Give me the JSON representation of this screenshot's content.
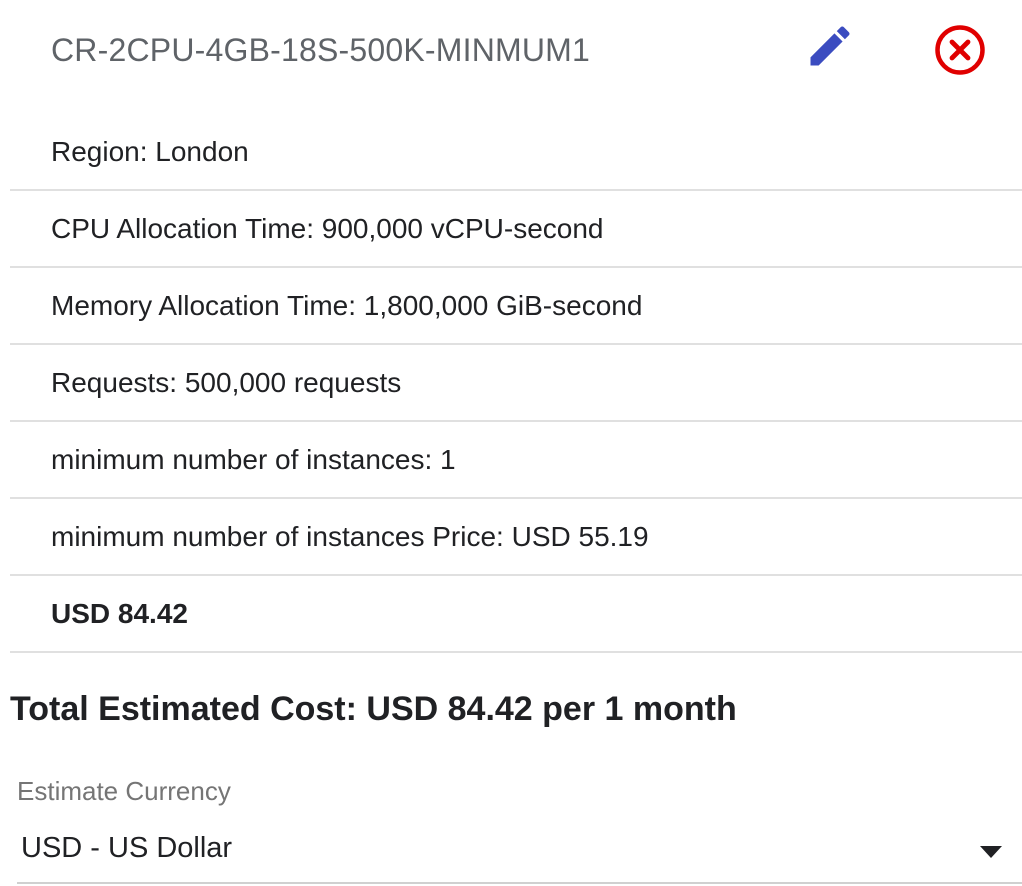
{
  "estimate_item": {
    "title": "CR-2CPU-4GB-18S-500K-MINMUM1",
    "edit_icon": "pencil-icon",
    "close_icon": "close-circle-icon",
    "accent_color": "#3b4cc0",
    "close_color": "#e00000",
    "details": [
      {
        "text": "Region: London"
      },
      {
        "text": "CPU Allocation Time: 900,000 vCPU-second"
      },
      {
        "text": "Memory Allocation Time: 1,800,000 GiB-second"
      },
      {
        "text": "Requests: 500,000 requests"
      },
      {
        "text": "minimum number of instances: 1"
      },
      {
        "text": "minimum number of instances Price: USD 55.19"
      }
    ],
    "subtotal": "USD 84.42"
  },
  "total": {
    "text": "Total Estimated Cost: USD 84.42 per 1 month"
  },
  "currency": {
    "label": "Estimate Currency",
    "selected": "USD - US Dollar"
  }
}
